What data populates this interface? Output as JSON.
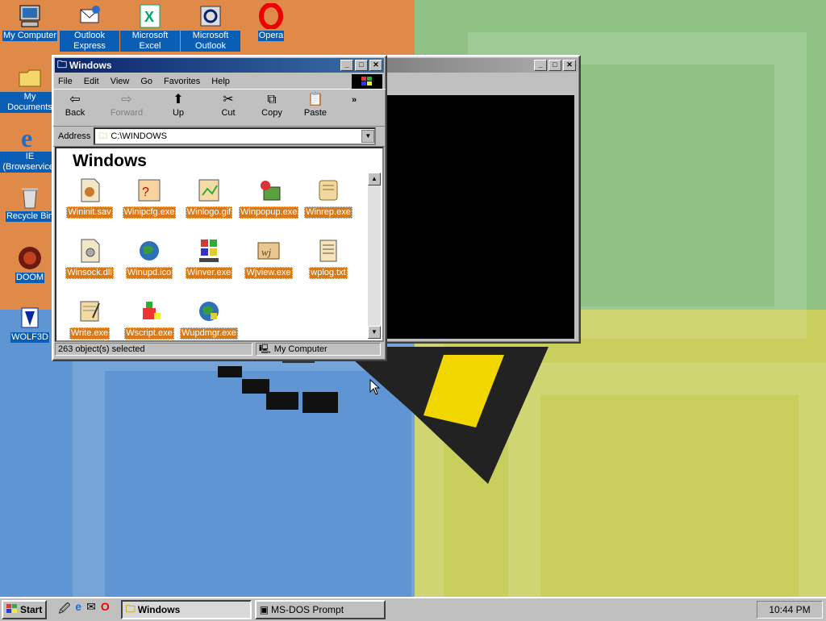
{
  "desktop": {
    "icons": [
      {
        "label": "My Computer"
      },
      {
        "label": "Outlook Express"
      },
      {
        "label": "Microsoft Excel"
      },
      {
        "label": "Microsoft Outlook"
      },
      {
        "label": "Opera"
      },
      {
        "label": "My Documents"
      },
      {
        "label": "IE (Browservice)"
      },
      {
        "label": "Recycle Bin"
      },
      {
        "label": "DOOM"
      },
      {
        "label": "WOLF3D"
      }
    ]
  },
  "explorer": {
    "title": "Windows",
    "menu": [
      "File",
      "Edit",
      "View",
      "Go",
      "Favorites",
      "Help"
    ],
    "toolbar": {
      "back": "Back",
      "forward": "Forward",
      "up": "Up",
      "cut": "Cut",
      "copy": "Copy",
      "paste": "Paste"
    },
    "address_label": "Address",
    "address_value": "C:\\WINDOWS",
    "heading": "Windows",
    "files": [
      {
        "name": "Wininit.sav"
      },
      {
        "name": "Winipcfg.exe"
      },
      {
        "name": "Winlogo.gif"
      },
      {
        "name": "Winpopup.exe"
      },
      {
        "name": "Winrep.exe"
      },
      {
        "name": "Winsock.dll"
      },
      {
        "name": "Winupd.ico"
      },
      {
        "name": "Winver.exe"
      },
      {
        "name": "Wjview.exe"
      },
      {
        "name": "wplog.txt"
      },
      {
        "name": "Write.exe"
      },
      {
        "name": "Wscript.exe"
      },
      {
        "name": "Wupdmgr.exe"
      }
    ],
    "status_left": "263 object(s) selected",
    "status_right": "My Computer"
  },
  "taskbar": {
    "start": "Start",
    "tasks": [
      "Windows",
      "MS-DOS Prompt"
    ],
    "clock": "10:44 PM"
  }
}
